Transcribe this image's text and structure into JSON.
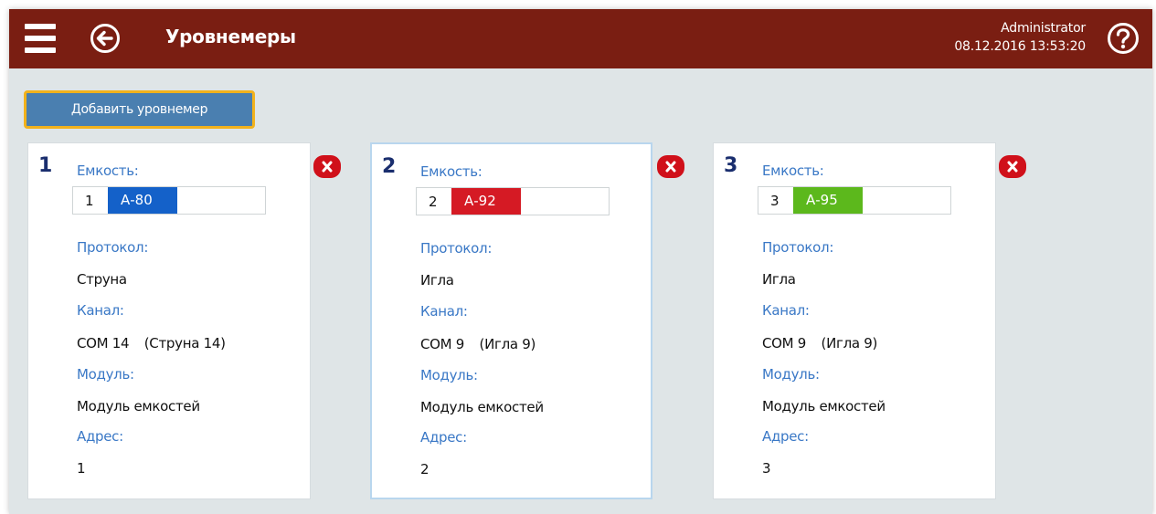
{
  "header": {
    "title": "Уровнемеры",
    "user": "Administrator",
    "datetime": "08.12.2016 13:53:20"
  },
  "toolbar": {
    "add_label": "Добавить уровнемер"
  },
  "colors": {
    "topbar": "#7a1e12",
    "label": "#3a78c6",
    "button": "#4a7fb0",
    "button_border": "#f2b21c",
    "remove": "#d0101a",
    "fuel_a80": "#1461c9",
    "fuel_a92": "#d51a24",
    "fuel_a95": "#5cb81c"
  },
  "cards": [
    {
      "number": "1",
      "tank_label": "Емкость:",
      "tank_number": "1",
      "fuel": "А-80",
      "protocol_label": "Протокол:",
      "protocol": "Струна",
      "channel_label": "Канал:",
      "channel": "COM 14",
      "channel_device": "(Струна 14)",
      "module_label": "Модуль:",
      "module": "Модуль емкостей",
      "address_label": "Адрес:",
      "address": "1"
    },
    {
      "number": "2",
      "tank_label": "Емкость:",
      "tank_number": "2",
      "fuel": "А-92",
      "protocol_label": "Протокол:",
      "protocol": "Игла",
      "channel_label": "Канал:",
      "channel": "COM 9",
      "channel_device": "(Игла 9)",
      "module_label": "Модуль:",
      "module": "Модуль емкостей",
      "address_label": "Адрес:",
      "address": "2"
    },
    {
      "number": "3",
      "tank_label": "Емкость:",
      "tank_number": "3",
      "fuel": "А-95",
      "protocol_label": "Протокол:",
      "protocol": "Игла",
      "channel_label": "Канал:",
      "channel": "COM 9",
      "channel_device": "(Игла 9)",
      "module_label": "Модуль:",
      "module": "Модуль емкостей",
      "address_label": "Адрес:",
      "address": "3"
    }
  ]
}
